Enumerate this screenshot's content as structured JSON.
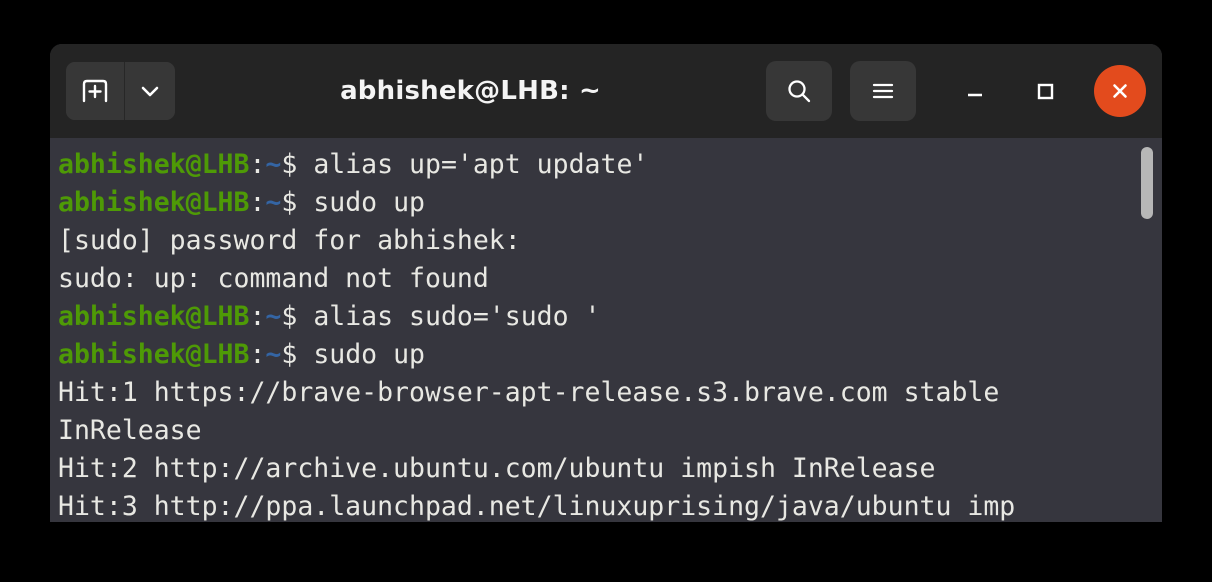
{
  "window": {
    "title": "abhishek@LHB: ~",
    "colors": {
      "titlebar_bg": "#242424",
      "terminal_bg": "#36363e",
      "button_bg": "#373737",
      "close_bg": "#e34b1d",
      "prompt_green": "#4e9a06",
      "prompt_blue": "#3465a4",
      "text_fg": "#e8e8e3",
      "scrollbar_thumb": "#b7b7b7",
      "desktop_bg": "#000000"
    }
  },
  "titlebar": {
    "new_tab_label": "new-tab-icon",
    "tab_menu_label": "chevron-down-icon",
    "search_label": "search-icon",
    "menu_label": "hamburger-menu-icon",
    "minimize_label": "minimize-icon",
    "maximize_label": "maximize-icon",
    "close_label": "close-icon"
  },
  "terminal": {
    "prompt_user_host": "abhishek@LHB",
    "prompt_colon": ":",
    "prompt_path": "~",
    "prompt_sigil": "$ ",
    "lines": [
      {
        "type": "prompt",
        "command": "alias up='apt update'"
      },
      {
        "type": "prompt",
        "command": "sudo up"
      },
      {
        "type": "output",
        "text": "[sudo] password for abhishek:"
      },
      {
        "type": "output",
        "text": "sudo: up: command not found"
      },
      {
        "type": "prompt",
        "command": "alias sudo='sudo '"
      },
      {
        "type": "prompt",
        "command": "sudo up"
      },
      {
        "type": "output",
        "text": "Hit:1 https://brave-browser-apt-release.s3.brave.com stable"
      },
      {
        "type": "output",
        "text": "InRelease"
      },
      {
        "type": "output",
        "text": "Hit:2 http://archive.ubuntu.com/ubuntu impish InRelease"
      },
      {
        "type": "output",
        "text": "Hit:3 http://ppa.launchpad.net/linuxuprising/java/ubuntu imp"
      }
    ]
  },
  "scrollbar": {
    "position_label": "scroll-thumb"
  }
}
